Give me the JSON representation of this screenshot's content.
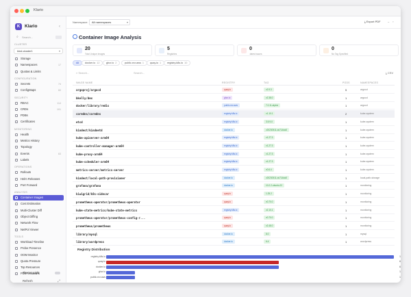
{
  "window": {
    "title": "Klario"
  },
  "sidebar": {
    "app_name": "Klario",
    "logo_letter": "K",
    "search_placeholder": "Search...",
    "cluster_label": "CLUSTER",
    "cluster_value": "kind-cluster1",
    "groups": [
      {
        "label": "",
        "items": [
          {
            "label": "Storage"
          },
          {
            "label": "Namespaces",
            "count": "17"
          },
          {
            "label": "Quotas & Limits"
          }
        ]
      },
      {
        "label": "CONFIGURATION",
        "items": [
          {
            "label": "Secrets",
            "count": "74"
          },
          {
            "label": "ConfigMaps",
            "count": "60"
          }
        ]
      },
      {
        "label": "SECURITY",
        "items": [
          {
            "label": "RBAC",
            "count": "114"
          },
          {
            "label": "CRDs",
            "count": "101"
          },
          {
            "label": "PDBs"
          },
          {
            "label": "Certificates"
          }
        ]
      },
      {
        "label": "MONITORING",
        "items": [
          {
            "label": "Health"
          },
          {
            "label": "Metrics History"
          },
          {
            "label": "Topology"
          },
          {
            "label": "Events",
            "count": "63"
          },
          {
            "label": "Labels"
          }
        ]
      },
      {
        "label": "OPERATIONS",
        "items": [
          {
            "label": "Rollouts"
          },
          {
            "label": "Helm Releases"
          },
          {
            "label": "Port Forward"
          }
        ]
      },
      {
        "label": "ANALYSIS",
        "items": [
          {
            "label": "Container Images",
            "active": true
          },
          {
            "label": "Cost Estimation"
          },
          {
            "label": "Multi-Cluster Diff"
          },
          {
            "label": "Object Diffing"
          },
          {
            "label": "Network Flow"
          },
          {
            "label": "NetPol Viewer"
          }
        ]
      },
      {
        "label": "TOOLS",
        "items": [
          {
            "label": "Workload Timeline"
          },
          {
            "label": "Probe Presence"
          },
          {
            "label": "OOM Monitor"
          },
          {
            "label": "Quota Pressure"
          },
          {
            "label": "Top Resources"
          },
          {
            "label": "PDB Violations"
          }
        ]
      }
    ],
    "theme_label": "Theme: Light",
    "refresh_label": "Refresh"
  },
  "topbar": {
    "namespace_label": "Namespace:",
    "namespace_value": "All namespaces",
    "export_label": "Export PDF"
  },
  "main": {
    "title": "Container Image Analysis",
    "stats": [
      {
        "value": "20",
        "label": "Total Unique Images",
        "color": "#e3e8fb",
        "icon": "layers-icon"
      },
      {
        "value": "5",
        "label": "Registries",
        "color": "#e8f0fb",
        "icon": "server-icon"
      },
      {
        "value": "0",
        "label": ":latest issues",
        "color": "#fde8e8",
        "icon": "alert-icon"
      },
      {
        "value": "0",
        "label": "No Tag Specified",
        "color": "#fdf0e3",
        "icon": "tag-icon"
      }
    ],
    "chips": [
      {
        "label": "All",
        "count": "",
        "active": true
      },
      {
        "label": "docker.io",
        "count": "12"
      },
      {
        "label": "ghcr.io",
        "count": "2"
      },
      {
        "label": "public.ecr.aws",
        "count": "1"
      },
      {
        "label": "quay.io",
        "count": "1"
      },
      {
        "label": "registry.k8s.io",
        "count": "10"
      }
    ],
    "search_placeholder": "Search...",
    "search_placeholder2": "Search...",
    "csv_label": "CSV",
    "columns": [
      "IMAGE NAME",
      "REGISTRY",
      "TAG",
      "PODS",
      "NAMESPACES"
    ],
    "rows": [
      {
        "name": "argoproj/argocd",
        "registry": "quay.io",
        "tag": "v2.9.3",
        "pods": "5",
        "ns": "argocd"
      },
      {
        "name": "bkelly/dex",
        "registry": "ghcr.io",
        "tag": "v2.38.0",
        "pods": "1",
        "ns": "argocd"
      },
      {
        "name": "docker/library/redis",
        "registry": "public.ecr.aws",
        "tag": "7.0.11-alpine",
        "pods": "1",
        "ns": "argocd"
      },
      {
        "name": "coredns/coredns",
        "registry": "registry.k8s.io",
        "tag": "v1.10.1",
        "pods": "2",
        "ns": "kube-system"
      },
      {
        "name": "etcd",
        "registry": "registry.k8s.io",
        "tag": "3.5.9-0",
        "pods": "1",
        "ns": "kube-system"
      },
      {
        "name": "kindest/kindnetd",
        "registry": "docker.io",
        "tag": "v20230511-dc714da8",
        "pods": "1",
        "ns": "kube-system"
      },
      {
        "name": "kube-apiserver-arm64",
        "registry": "registry.k8s.io",
        "tag": "v1.27.3",
        "pods": "1",
        "ns": "kube-system"
      },
      {
        "name": "kube-controller-manager-arm64",
        "registry": "registry.k8s.io",
        "tag": "v1.27.3",
        "pods": "1",
        "ns": "kube-system"
      },
      {
        "name": "kube-proxy-arm64",
        "registry": "registry.k8s.io",
        "tag": "v1.27.3",
        "pods": "1",
        "ns": "kube-system"
      },
      {
        "name": "kube-scheduler-arm64",
        "registry": "registry.k8s.io",
        "tag": "v1.27.3",
        "pods": "1",
        "ns": "kube-system"
      },
      {
        "name": "metrics-server/metrics-server",
        "registry": "registry.k8s.io",
        "tag": "v0.6.4",
        "pods": "1",
        "ns": "kube-system"
      },
      {
        "name": "kindest/local-path-provisioner",
        "registry": "docker.io",
        "tag": "v20230511-dc714da8",
        "pods": "1",
        "ns": "local-path-storage"
      },
      {
        "name": "grafana/grafana",
        "registry": "docker.io",
        "tag": "10.2.2-ubuntu.22",
        "pods": "1",
        "ns": "monitoring"
      },
      {
        "name": "kiwigrid/k8s-sidecar",
        "registry": "quay.io",
        "tag": "1.25.2",
        "pods": "1",
        "ns": "monitoring"
      },
      {
        "name": "prometheus-operator/prometheus-operator",
        "registry": "quay.io",
        "tag": "v0.70.0",
        "pods": "1",
        "ns": "monitoring"
      },
      {
        "name": "kube-state-metrics/kube-state-metrics",
        "registry": "registry.k8s.io",
        "tag": "v2.10.1",
        "pods": "1",
        "ns": "monitoring"
      },
      {
        "name": "prometheus-operator/prometheus-config-r...",
        "registry": "quay.io",
        "tag": "v0.70.0",
        "pods": "1",
        "ns": "monitoring"
      },
      {
        "name": "prometheus/prometheus",
        "registry": "quay.io",
        "tag": "v2.48.0",
        "pods": "1",
        "ns": "monitoring"
      },
      {
        "name": "library/mysql",
        "registry": "docker.io",
        "tag": "8.0",
        "pods": "1",
        "ns": "mysql"
      },
      {
        "name": "library/wordpress",
        "registry": "docker.io",
        "tag": "6.4",
        "pods": "1",
        "ns": "wordpress"
      }
    ],
    "distribution": {
      "title": "Registry Distribution",
      "bars": [
        {
          "label": "registry.k8s.io",
          "value": 10,
          "color": "#5468d8"
        },
        {
          "label": "quay.io",
          "value": 6,
          "color": "#c62828"
        },
        {
          "label": "docker.io",
          "value": 6,
          "color": "#5468d8"
        },
        {
          "label": "ghcr.io",
          "value": 1,
          "color": "#5468d8"
        },
        {
          "label": "public.ecr.aws",
          "value": 1,
          "color": "#5468d8"
        }
      ]
    }
  }
}
